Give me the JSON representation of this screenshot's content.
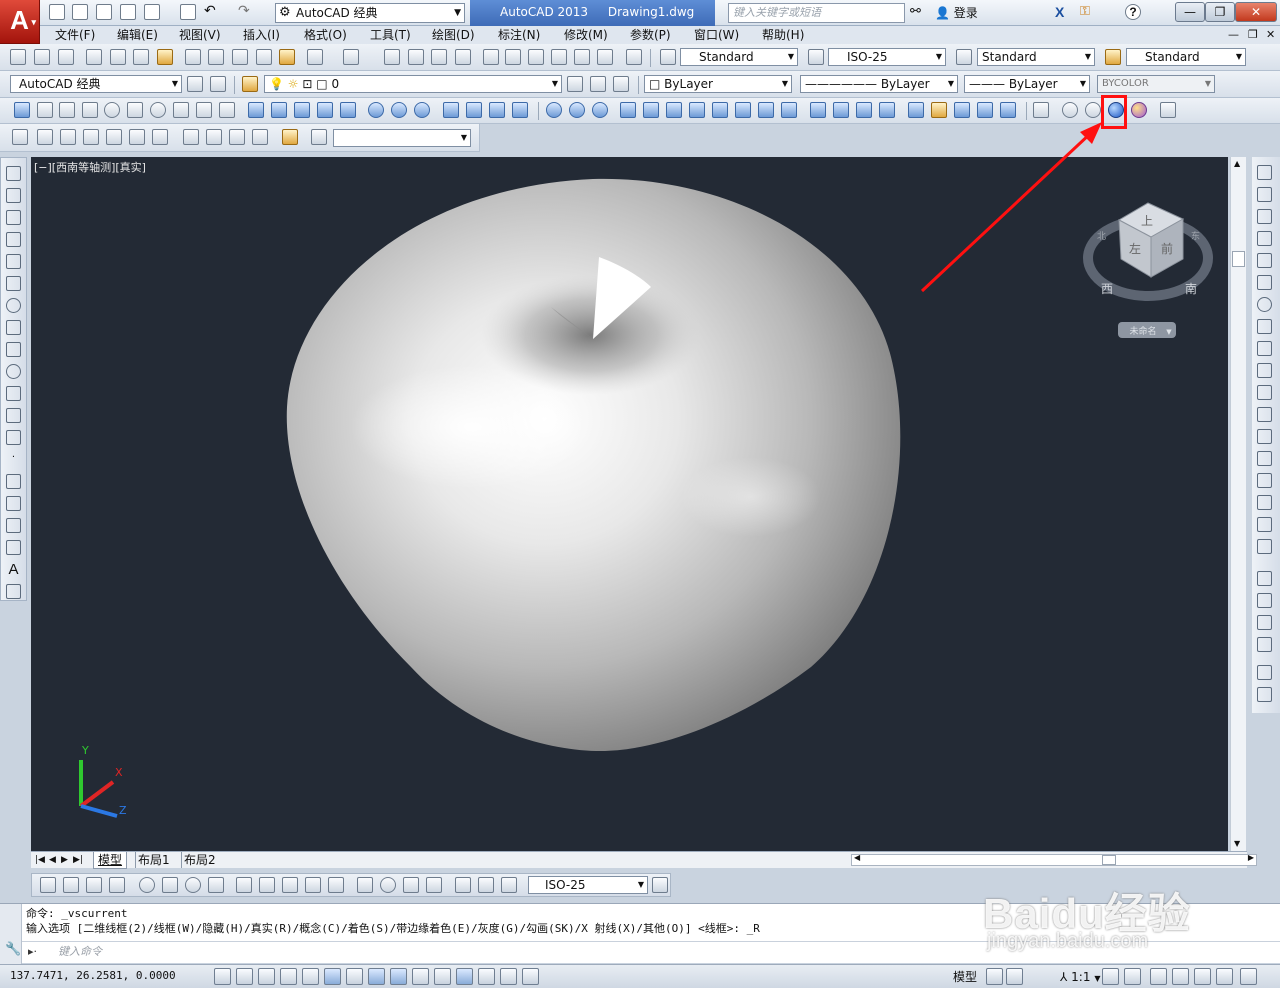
{
  "app": {
    "logo_letter": "A",
    "workspace": "AutoCAD 经典",
    "product": "AutoCAD 2013",
    "file": "Drawing1.dwg",
    "search_placeholder": "键入关键字或短语",
    "login": "登录"
  },
  "menu": [
    "文件(F)",
    "编辑(E)",
    "视图(V)",
    "插入(I)",
    "格式(O)",
    "工具(T)",
    "绘图(D)",
    "标注(N)",
    "修改(M)",
    "参数(P)",
    "窗口(W)",
    "帮助(H)"
  ],
  "styles": {
    "text_style": "Standard",
    "dim_style": "ISO-25",
    "table_style": "Standard",
    "multileader_style": "Standard"
  },
  "layers": {
    "workspace": "AutoCAD 经典",
    "layer": "0",
    "color": "ByLayer",
    "linetype": "ByLayer",
    "lineweight": "ByLayer",
    "plotstyle": "BYCOLOR"
  },
  "viewport": {
    "label": "[−][西南等轴测][真实]",
    "viewcube": {
      "top_face": "上",
      "left_face": "左",
      "front_face": "前",
      "compass_west": "西",
      "compass_south": "南",
      "compass_north": "北",
      "compass_east": "东",
      "wcs_label": "未命名"
    },
    "ucs": {
      "y": "Y",
      "x": "X",
      "z": "Z"
    }
  },
  "tabs": [
    "模型",
    "布局1",
    "布局2"
  ],
  "dim_toolbar": {
    "dim_style": "ISO-25"
  },
  "command": {
    "line1": "命令: _vscurrent",
    "line2": "输入选项 [二维线框(2)/线框(W)/隐藏(H)/真实(R)/概念(C)/着色(S)/带边缘着色(E)/灰度(G)/勾画(SK)/X 射线(X)/其他(O)] <线框>: _R",
    "input_placeholder": "键入命令"
  },
  "status": {
    "coords": "137.7471, 26.2581, 0.0000",
    "model": "模型",
    "scale": "1:1"
  },
  "watermark": {
    "main": "Baidu经验",
    "sub": "jingyan.baidu.com"
  },
  "colors": {
    "canvas": "#232a35",
    "annotation": "#ff1010",
    "title_accent": "#3e6bb7"
  }
}
